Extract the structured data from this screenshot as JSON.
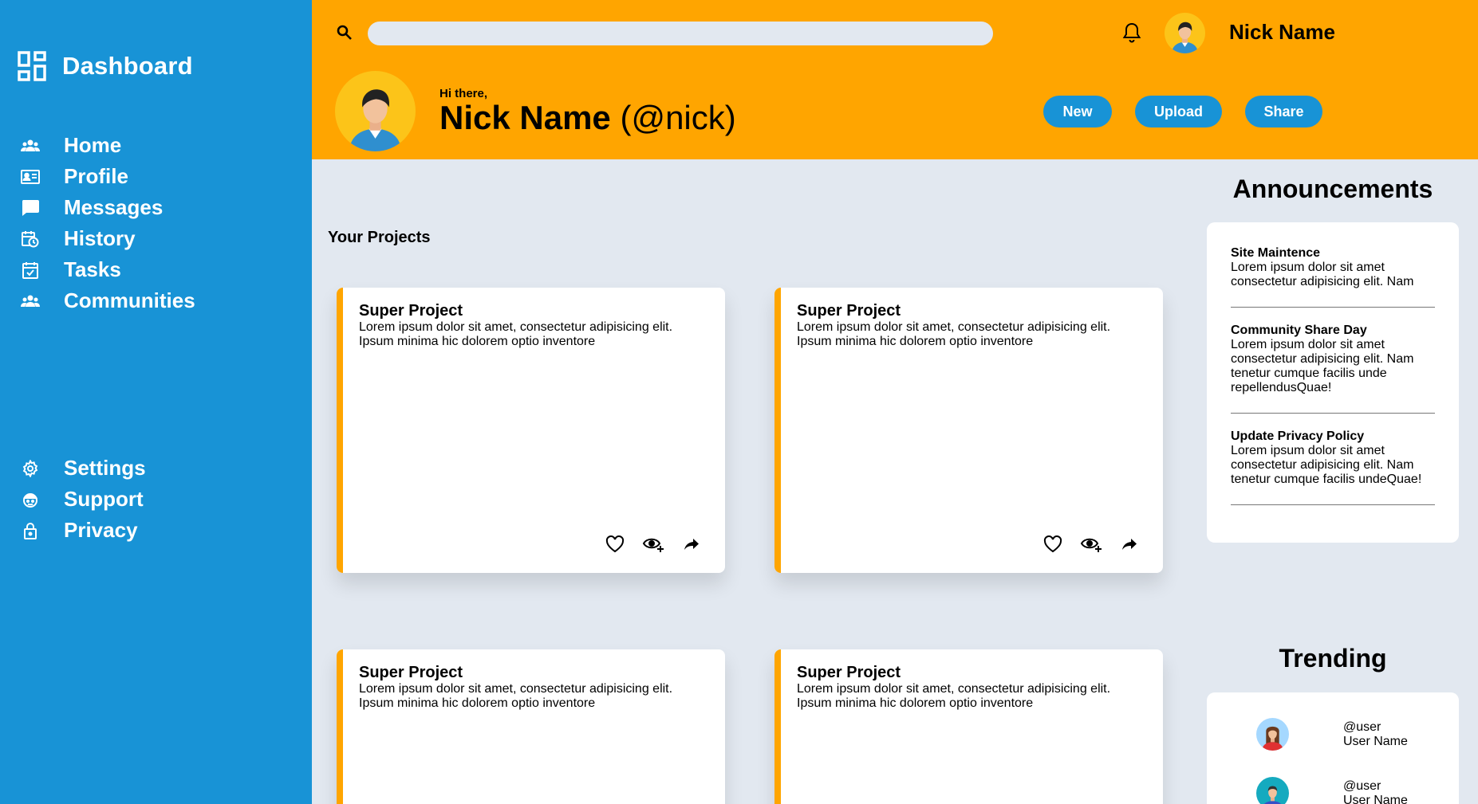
{
  "sidebar": {
    "brand": "Dashboard",
    "main_items": [
      {
        "label": "Home",
        "icon": "group-icon"
      },
      {
        "label": "Profile",
        "icon": "id-card-icon"
      },
      {
        "label": "Messages",
        "icon": "chat-icon"
      },
      {
        "label": "History",
        "icon": "history-icon"
      },
      {
        "label": "Tasks",
        "icon": "calendar-check-icon"
      },
      {
        "label": "Communities",
        "icon": "community-icon"
      }
    ],
    "bottom_items": [
      {
        "label": "Settings",
        "icon": "gear-icon"
      },
      {
        "label": "Support",
        "icon": "support-icon"
      },
      {
        "label": "Privacy",
        "icon": "lock-icon"
      }
    ]
  },
  "header": {
    "search_placeholder": "",
    "user_name": "Nick Name",
    "greeting": "Hi there,",
    "display_name": "Nick Name",
    "handle": "(@nick)",
    "buttons": {
      "new": "New",
      "upload": "Upload",
      "share": "Share"
    }
  },
  "projects": {
    "title": "Your Projects",
    "cards": [
      {
        "title": "Super Project",
        "text": "Lorem ipsum dolor sit amet, consectetur adipisicing elit. Ipsum minima hic dolorem optio inventore"
      },
      {
        "title": "Super Project",
        "text": "Lorem ipsum dolor sit amet, consectetur adipisicing elit. Ipsum minima hic dolorem optio inventore"
      },
      {
        "title": "Super Project",
        "text": "Lorem ipsum dolor sit amet, consectetur adipisicing elit. Ipsum minima hic dolorem optio inventore"
      },
      {
        "title": "Super Project",
        "text": "Lorem ipsum dolor sit amet, consectetur adipisicing elit. Ipsum minima hic dolorem optio inventore"
      }
    ]
  },
  "announcements": {
    "title": "Announcements",
    "items": [
      {
        "title": "Site Maintence",
        "text": "Lorem ipsum dolor sit amet consectetur adipisicing elit. Nam"
      },
      {
        "title": "Community Share Day",
        "text": "Lorem ipsum dolor sit amet consectetur adipisicing elit. Nam tenetur cumque facilis unde repellendusQuae!"
      },
      {
        "title": "Update Privacy Policy",
        "text": "Lorem ipsum dolor sit amet consectetur adipisicing elit. Nam tenetur cumque facilis undeQuae!"
      }
    ]
  },
  "trending": {
    "title": "Trending",
    "items": [
      {
        "handle": "@user",
        "name": "User Name"
      },
      {
        "handle": "@user",
        "name": "User Name"
      }
    ]
  },
  "colors": {
    "accent": "#ffa500",
    "primary": "#1893d6",
    "background": "#e2e8f0"
  }
}
